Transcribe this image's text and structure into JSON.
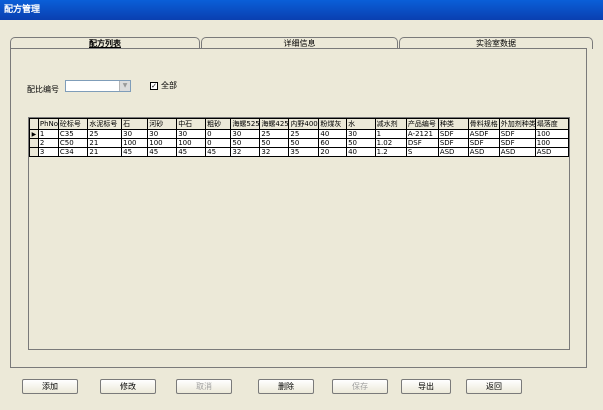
{
  "window": {
    "title": "配方管理"
  },
  "tabs": [
    {
      "label": "配方列表"
    },
    {
      "label": "详细信息"
    },
    {
      "label": "实验室数据"
    }
  ],
  "filter": {
    "label": "配比编号",
    "value": "",
    "all_label": "全部",
    "all_checked": true
  },
  "table": {
    "columns": [
      "PhNo",
      "砼标号",
      "水泥标号",
      "石",
      "河砂",
      "中石",
      "粗砂",
      "海螺525",
      "海螺425",
      "内野400",
      "粉煤灰",
      "水",
      "减水剂",
      "产品编号",
      "种类",
      "骨料规格",
      "外加剂种类",
      "塌落度"
    ],
    "rows": [
      [
        "1",
        "C35",
        "25",
        "30",
        "30",
        "30",
        "0",
        "30",
        "25",
        "25",
        "40",
        "30",
        "1",
        "A-2121",
        "SDF",
        "ASDF",
        "SDF",
        "100"
      ],
      [
        "2",
        "C50",
        "21",
        "100",
        "100",
        "100",
        "0",
        "50",
        "50",
        "50",
        "60",
        "50",
        "1.02",
        "DSF",
        "SDF",
        "SDF",
        "SDF",
        "100"
      ],
      [
        "3",
        "C34",
        "21",
        "45",
        "45",
        "45",
        "45",
        "32",
        "32",
        "35",
        "20",
        "40",
        "1.2",
        "S",
        "ASD",
        "ASD",
        "ASD",
        "ASD"
      ]
    ],
    "current_row_marker": "▶"
  },
  "buttons": {
    "add": "添加",
    "edit": "修改",
    "cancel": "取消",
    "delete": "删除",
    "save": "保存",
    "export": "导出",
    "back": "返回"
  }
}
